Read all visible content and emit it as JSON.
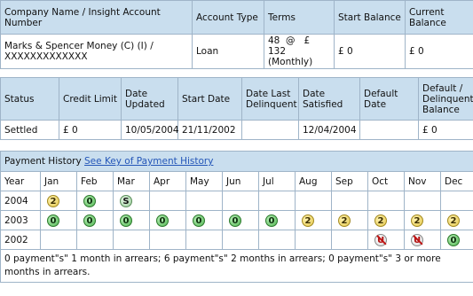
{
  "account": {
    "headers": [
      "Company Name / Insight Account Number",
      "Account Type",
      "Terms",
      "Start Balance",
      "Current Balance"
    ],
    "company_line1": "Marks & Spencer Money (C) (I) /",
    "company_line2": "XXXXXXXXXXXXX",
    "account_type": "Loan",
    "terms_line1": "48  @   £",
    "terms_line2": "132 (Monthly)",
    "start_balance": "£ 0",
    "current_balance": "£ 0"
  },
  "status": {
    "headers": [
      "Status",
      "Credit Limit",
      "Date Updated",
      "Start Date",
      "Date Last Delinquent",
      "Date Satisfied",
      "Default Date",
      "Default / Delinquent Balance"
    ],
    "values": [
      "Settled",
      "£ 0",
      "10/05/2004",
      "21/11/2002",
      "",
      "12/04/2004",
      "",
      "£ 0"
    ]
  },
  "payment_history": {
    "title": "Payment History",
    "key_link": "See Key of Payment History",
    "year_header": "Year",
    "months": [
      "Jan",
      "Feb",
      "Mar",
      "Apr",
      "May",
      "Jun",
      "Jul",
      "Aug",
      "Sep",
      "Oct",
      "Nov",
      "Dec"
    ],
    "rows": [
      {
        "year": "2004",
        "cells": [
          "2",
          "0",
          "S",
          "",
          "",
          "",
          "",
          "",
          "",
          "",
          "",
          ""
        ]
      },
      {
        "year": "2003",
        "cells": [
          "0",
          "0",
          "0",
          "0",
          "0",
          "0",
          "0",
          "2",
          "2",
          "2",
          "2",
          "2"
        ]
      },
      {
        "year": "2002",
        "cells": [
          "",
          "",
          "",
          "",
          "",
          "",
          "",
          "",
          "",
          "U",
          "U",
          "0"
        ]
      }
    ],
    "summary": "0 payment\"s\" 1 month in arrears; 6 payment\"s\" 2 months in arrears; 0 payment\"s\" 3 or more months in arrears."
  },
  "colors": {
    "header_bg": "#c9deee",
    "border": "#9fb4c8",
    "link": "#2456b8",
    "status_ok": "#4fb44f",
    "status_late": "#e3c64b",
    "status_unknown": "#c01515"
  }
}
